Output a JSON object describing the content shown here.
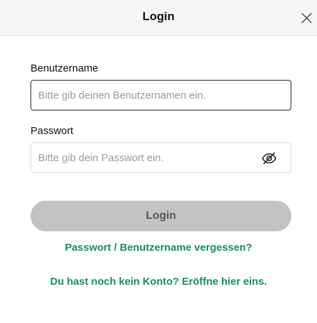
{
  "header": {
    "title": "Login",
    "close_icon": "close-icon"
  },
  "form": {
    "username_label": "Benutzername",
    "username_placeholder": "Bitte gib deinen Benutzernamen ein.",
    "username_value": "",
    "password_label": "Passwort",
    "password_placeholder": "Bitte gib dein Passwort ein.",
    "password_value": "",
    "password_toggle_icon": "eye-slash-icon",
    "login_label": "Login"
  },
  "links": {
    "forgot": "Passwort / Benutzername vergessen?",
    "register": "Du hast noch kein Konto? Eröffne hier eins."
  },
  "colors": {
    "accent": "#1a8a6e",
    "button_disabled": "#c3c3c3",
    "header_bg": "#f6f6f6"
  }
}
